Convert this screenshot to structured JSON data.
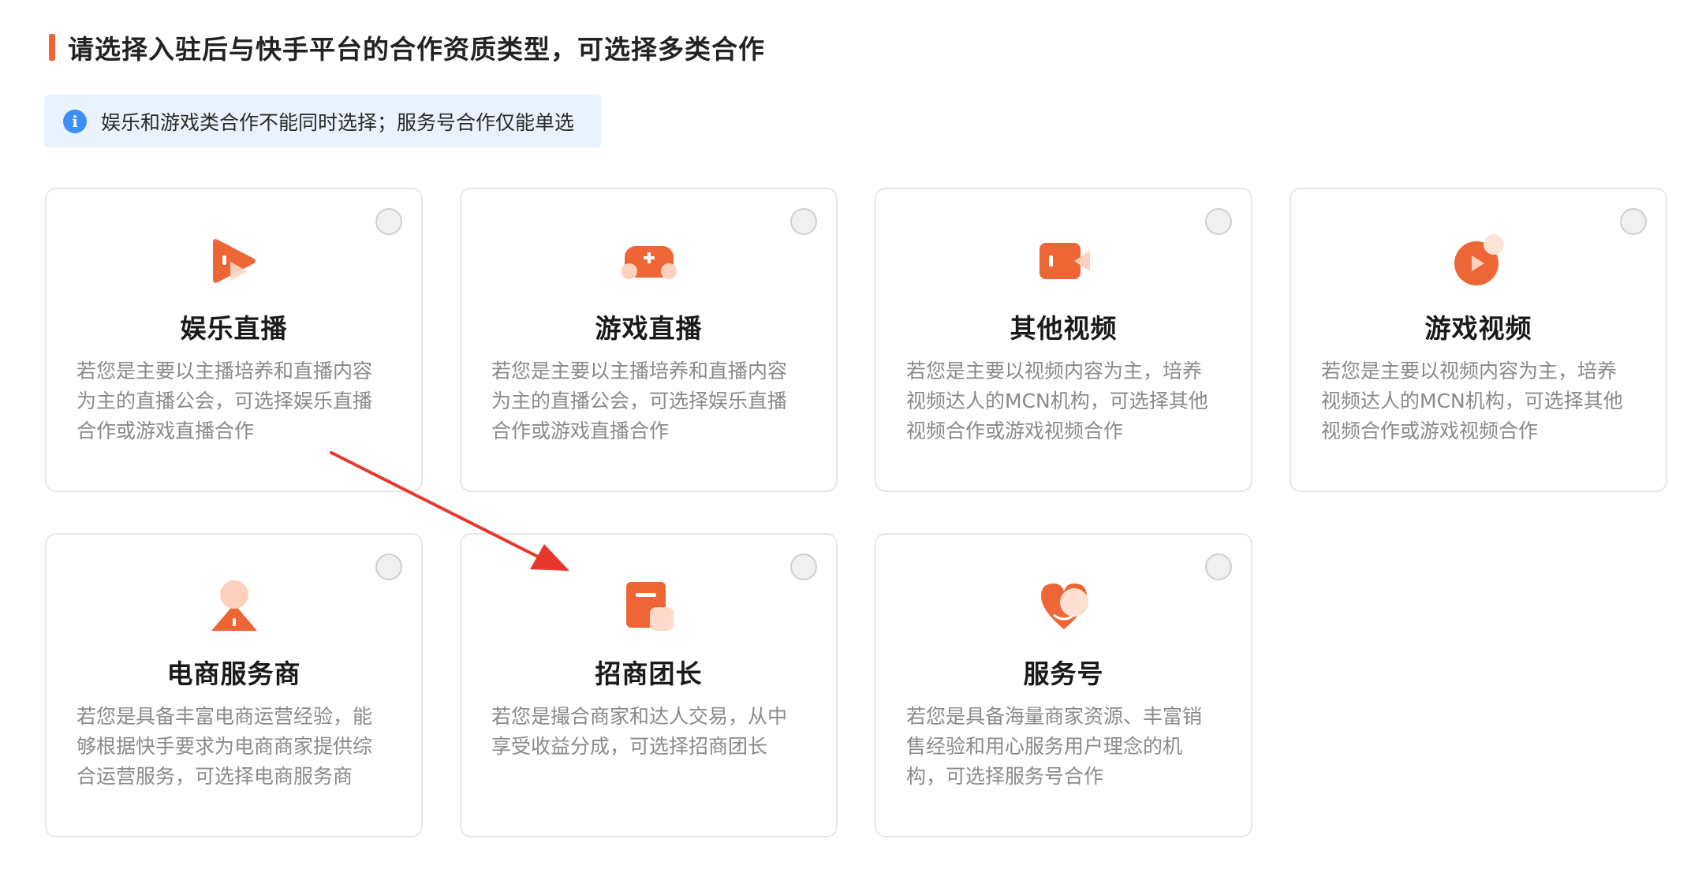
{
  "header": {
    "title": "请选择入驻后与快手平台的合作资质类型，可选择多类合作"
  },
  "notice": {
    "icon": "info-icon",
    "icon_glyph": "i",
    "text": "娱乐和游戏类合作不能同时选择；服务号合作仅能单选"
  },
  "colors": {
    "accent": "#ee6536",
    "info": "#3e8ef7",
    "notice_bg": "#eaf3fd",
    "arrow": "#e8372c"
  },
  "cards": [
    {
      "icon": "play-icon",
      "title": "娱乐直播",
      "desc": "若您是主要以主播培养和直播内容为主的直播公会，可选择娱乐直播合作或游戏直播合作",
      "selected": false
    },
    {
      "icon": "gamepad-icon",
      "title": "游戏直播",
      "desc": "若您是主要以主播培养和直播内容为主的直播公会，可选择娱乐直播合作或游戏直播合作",
      "selected": false
    },
    {
      "icon": "video-camera-icon",
      "title": "其他视频",
      "desc": "若您是主要以视频内容为主，培养视频达人的MCN机构，可选择其他视频合作或游戏视频合作",
      "selected": false
    },
    {
      "icon": "video-play-circle-icon",
      "title": "游戏视频",
      "desc": "若您是主要以视频内容为主，培养视频达人的MCN机构，可选择其他视频合作或游戏视频合作",
      "selected": false
    },
    {
      "icon": "person-icon",
      "title": "电商服务商",
      "desc": "若您是具备丰富电商运营经验，能够根据快手要求为电商商家提供综合运营服务，可选择电商服务商",
      "selected": false
    },
    {
      "icon": "document-icon",
      "title": "招商团长",
      "desc": "若您是撮合商家和达人交易，从中享受收益分成，可选择招商团长",
      "selected": false
    },
    {
      "icon": "heart-icon",
      "title": "服务号",
      "desc": "若您是具备海量商家资源、丰富销售经验和用心服务用户理念的机构，可选择服务号合作",
      "selected": false
    }
  ]
}
